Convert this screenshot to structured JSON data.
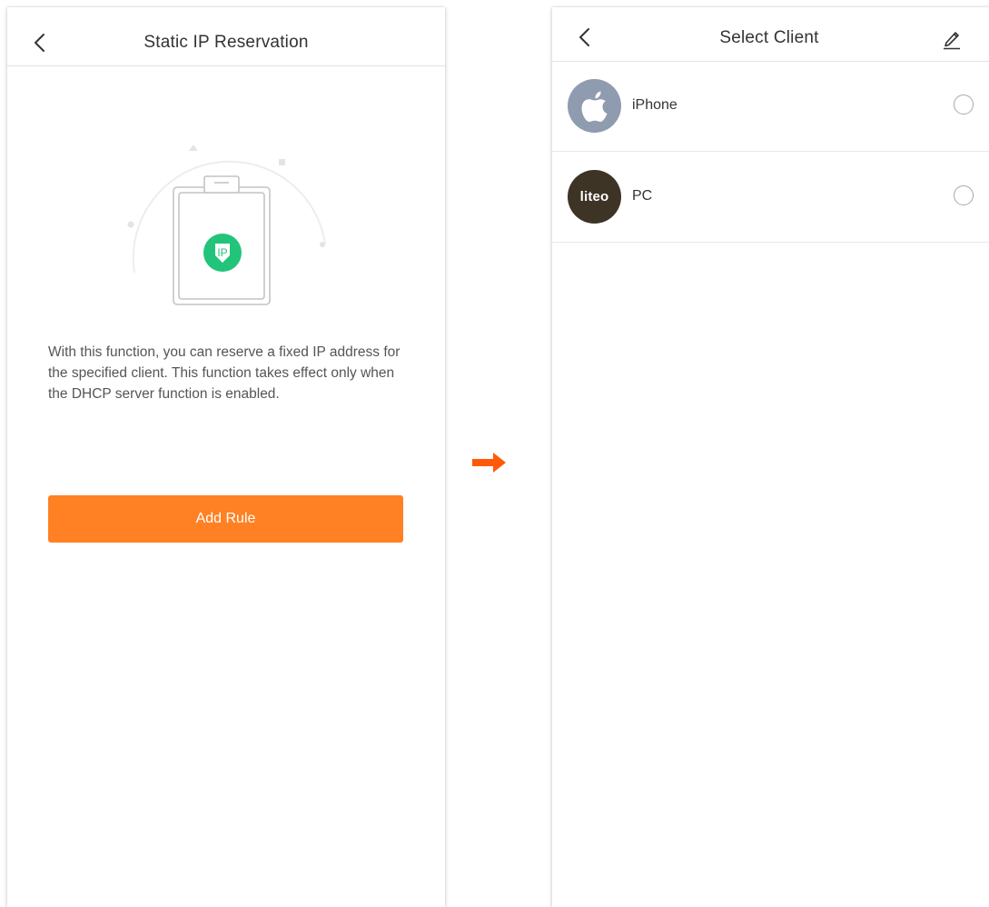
{
  "left_screen": {
    "title": "Static IP Reservation",
    "back_icon": "chevron-left-icon",
    "badge_text": "IP",
    "description": "With this function, you can reserve a fixed IP address for the specified client. This function takes effect only when the DHCP server function is enabled.",
    "add_rule_label": "Add Rule",
    "accent_color": "#ff8124",
    "badge_color": "#22c47a"
  },
  "transition_icon": "right-arrow-icon",
  "right_screen": {
    "title": "Select Client",
    "back_icon": "chevron-left-icon",
    "edit_icon": "pencil-icon",
    "clients": [
      {
        "name": "iPhone",
        "avatar_icon": "apple-icon",
        "selected": false
      },
      {
        "name": "PC",
        "avatar_text": "liteo",
        "selected": false
      }
    ]
  }
}
